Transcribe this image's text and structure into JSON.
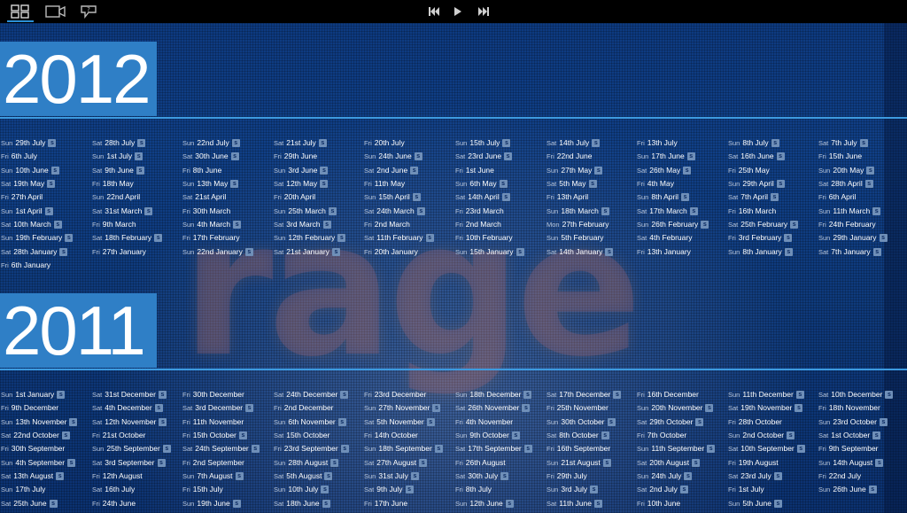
{
  "toolbar": {
    "icons": [
      "grid-view-icon",
      "video-camera-icon",
      "help-icon",
      "skip-back-icon",
      "play-icon",
      "skip-forward-icon"
    ]
  },
  "s_label": "s",
  "sections": [
    {
      "year": "2012",
      "entries": [
        {
          "day": "Sun",
          "date": "29th July",
          "s": true
        },
        {
          "day": "Sat",
          "date": "28th July",
          "s": true
        },
        {
          "day": "Sun",
          "date": "22nd July",
          "s": true
        },
        {
          "day": "Sat",
          "date": "21st July",
          "s": true
        },
        {
          "day": "Fri",
          "date": "20th July",
          "s": false
        },
        {
          "day": "Sun",
          "date": "15th July",
          "s": true
        },
        {
          "day": "Sat",
          "date": "14th July",
          "s": true
        },
        {
          "day": "Fri",
          "date": "13th July",
          "s": false
        },
        {
          "day": "Sun",
          "date": "8th July",
          "s": true
        },
        {
          "day": "Sat",
          "date": "7th July",
          "s": true
        },
        {
          "day": "Fri",
          "date": "6th July",
          "s": false
        },
        {
          "day": "Sun",
          "date": "1st July",
          "s": true
        },
        {
          "day": "Sat",
          "date": "30th June",
          "s": true
        },
        {
          "day": "Fri",
          "date": "29th June",
          "s": false
        },
        {
          "day": "Sun",
          "date": "24th June",
          "s": true
        },
        {
          "day": "Sat",
          "date": "23rd June",
          "s": true
        },
        {
          "day": "Fri",
          "date": "22nd June",
          "s": false
        },
        {
          "day": "Sun",
          "date": "17th June",
          "s": true
        },
        {
          "day": "Sat",
          "date": "16th June",
          "s": true
        },
        {
          "day": "Fri",
          "date": "15th June",
          "s": false
        },
        {
          "day": "Sun",
          "date": "10th June",
          "s": true
        },
        {
          "day": "Sat",
          "date": "9th June",
          "s": true
        },
        {
          "day": "Fri",
          "date": "8th June",
          "s": false
        },
        {
          "day": "Sun",
          "date": "3rd June",
          "s": true
        },
        {
          "day": "Sat",
          "date": "2nd June",
          "s": true
        },
        {
          "day": "Fri",
          "date": "1st June",
          "s": false
        },
        {
          "day": "Sun",
          "date": "27th May",
          "s": true
        },
        {
          "day": "Sat",
          "date": "26th May",
          "s": true
        },
        {
          "day": "Fri",
          "date": "25th May",
          "s": false
        },
        {
          "day": "Sun",
          "date": "20th May",
          "s": true
        },
        {
          "day": "Sat",
          "date": "19th May",
          "s": true
        },
        {
          "day": "Fri",
          "date": "18th May",
          "s": false
        },
        {
          "day": "Sun",
          "date": "13th May",
          "s": true
        },
        {
          "day": "Sat",
          "date": "12th May",
          "s": true
        },
        {
          "day": "Fri",
          "date": "11th May",
          "s": false
        },
        {
          "day": "Sun",
          "date": "6th May",
          "s": true
        },
        {
          "day": "Sat",
          "date": "5th May",
          "s": true
        },
        {
          "day": "Fri",
          "date": "4th May",
          "s": false
        },
        {
          "day": "Sun",
          "date": "29th April",
          "s": true
        },
        {
          "day": "Sat",
          "date": "28th April",
          "s": true
        },
        {
          "day": "Fri",
          "date": "27th April",
          "s": false
        },
        {
          "day": "Sun",
          "date": "22nd April",
          "s": false
        },
        {
          "day": "Sat",
          "date": "21st April",
          "s": false
        },
        {
          "day": "Fri",
          "date": "20th April",
          "s": false
        },
        {
          "day": "Sun",
          "date": "15th April",
          "s": true
        },
        {
          "day": "Sat",
          "date": "14th April",
          "s": true
        },
        {
          "day": "Fri",
          "date": "13th April",
          "s": false
        },
        {
          "day": "Sun",
          "date": "8th April",
          "s": true
        },
        {
          "day": "Sat",
          "date": "7th April",
          "s": true
        },
        {
          "day": "Fri",
          "date": "6th April",
          "s": false
        },
        {
          "day": "Sun",
          "date": "1st April",
          "s": true
        },
        {
          "day": "Sat",
          "date": "31st March",
          "s": true
        },
        {
          "day": "Fri",
          "date": "30th March",
          "s": false
        },
        {
          "day": "Sun",
          "date": "25th March",
          "s": true
        },
        {
          "day": "Sat",
          "date": "24th March",
          "s": true
        },
        {
          "day": "Fri",
          "date": "23rd March",
          "s": false
        },
        {
          "day": "Sun",
          "date": "18th March",
          "s": true
        },
        {
          "day": "Sat",
          "date": "17th March",
          "s": true
        },
        {
          "day": "Fri",
          "date": "16th March",
          "s": false
        },
        {
          "day": "Sun",
          "date": "11th March",
          "s": true
        },
        {
          "day": "Sat",
          "date": "10th March",
          "s": true
        },
        {
          "day": "Fri",
          "date": "9th March",
          "s": false
        },
        {
          "day": "Sun",
          "date": "4th March",
          "s": true
        },
        {
          "day": "Sat",
          "date": "3rd March",
          "s": true
        },
        {
          "day": "Fri",
          "date": "2nd March",
          "s": false
        },
        {
          "day": "Fri",
          "date": "2nd March",
          "s": false
        },
        {
          "day": "Mon",
          "date": "27th February",
          "s": false
        },
        {
          "day": "Sun",
          "date": "26th February",
          "s": true
        },
        {
          "day": "Sat",
          "date": "25th February",
          "s": true
        },
        {
          "day": "Fri",
          "date": "24th February",
          "s": false
        },
        {
          "day": "Sun",
          "date": "19th February",
          "s": true
        },
        {
          "day": "Sat",
          "date": "18th February",
          "s": true
        },
        {
          "day": "Fri",
          "date": "17th February",
          "s": false
        },
        {
          "day": "Sun",
          "date": "12th February",
          "s": true
        },
        {
          "day": "Sat",
          "date": "11th February",
          "s": true
        },
        {
          "day": "Fri",
          "date": "10th February",
          "s": false
        },
        {
          "day": "Sun",
          "date": "5th February",
          "s": false
        },
        {
          "day": "Sat",
          "date": "4th February",
          "s": false
        },
        {
          "day": "Fri",
          "date": "3rd February",
          "s": true
        },
        {
          "day": "Sun",
          "date": "29th January",
          "s": true
        },
        {
          "day": "Sat",
          "date": "28th January",
          "s": true
        },
        {
          "day": "Fri",
          "date": "27th January",
          "s": false
        },
        {
          "day": "Sun",
          "date": "22nd January",
          "s": true
        },
        {
          "day": "Sat",
          "date": "21st January",
          "s": true
        },
        {
          "day": "Fri",
          "date": "20th January",
          "s": false
        },
        {
          "day": "Sun",
          "date": "15th January",
          "s": true
        },
        {
          "day": "Sat",
          "date": "14th January",
          "s": true
        },
        {
          "day": "Fri",
          "date": "13th January",
          "s": false
        },
        {
          "day": "Sun",
          "date": "8th January",
          "s": true
        },
        {
          "day": "Sat",
          "date": "7th January",
          "s": true
        },
        {
          "day": "Fri",
          "date": "6th January",
          "s": false
        }
      ]
    },
    {
      "year": "2011",
      "entries": [
        {
          "day": "Sun",
          "date": "1st January",
          "s": true
        },
        {
          "day": "Sat",
          "date": "31st December",
          "s": true
        },
        {
          "day": "Fri",
          "date": "30th December",
          "s": false
        },
        {
          "day": "Sat",
          "date": "24th December",
          "s": true
        },
        {
          "day": "Fri",
          "date": "23rd December",
          "s": false
        },
        {
          "day": "Sun",
          "date": "18th December",
          "s": true
        },
        {
          "day": "Sat",
          "date": "17th December",
          "s": true
        },
        {
          "day": "Fri",
          "date": "16th December",
          "s": false
        },
        {
          "day": "Sun",
          "date": "11th December",
          "s": true
        },
        {
          "day": "Sat",
          "date": "10th December",
          "s": true
        },
        {
          "day": "Fri",
          "date": "9th December",
          "s": false
        },
        {
          "day": "Sat",
          "date": "4th December",
          "s": true
        },
        {
          "day": "Sat",
          "date": "3rd December",
          "s": true
        },
        {
          "day": "Fri",
          "date": "2nd December",
          "s": false
        },
        {
          "day": "Sun",
          "date": "27th November",
          "s": true
        },
        {
          "day": "Sat",
          "date": "26th November",
          "s": true
        },
        {
          "day": "Fri",
          "date": "25th November",
          "s": false
        },
        {
          "day": "Sun",
          "date": "20th November",
          "s": true
        },
        {
          "day": "Sat",
          "date": "19th November",
          "s": true
        },
        {
          "day": "Fri",
          "date": "18th November",
          "s": false
        },
        {
          "day": "Sun",
          "date": "13th November",
          "s": true
        },
        {
          "day": "Sat",
          "date": "12th November",
          "s": true
        },
        {
          "day": "Fri",
          "date": "11th November",
          "s": false
        },
        {
          "day": "Sun",
          "date": "6th November",
          "s": true
        },
        {
          "day": "Sat",
          "date": "5th November",
          "s": true
        },
        {
          "day": "Fri",
          "date": "4th November",
          "s": false
        },
        {
          "day": "Sun",
          "date": "30th October",
          "s": true
        },
        {
          "day": "Sat",
          "date": "29th October",
          "s": true
        },
        {
          "day": "Fri",
          "date": "28th October",
          "s": false
        },
        {
          "day": "Sun",
          "date": "23rd October",
          "s": true
        },
        {
          "day": "Sat",
          "date": "22nd October",
          "s": true
        },
        {
          "day": "Fri",
          "date": "21st October",
          "s": false
        },
        {
          "day": "Fri",
          "date": "15th October",
          "s": true
        },
        {
          "day": "Sat",
          "date": "15th October",
          "s": false
        },
        {
          "day": "Fri",
          "date": "14th October",
          "s": false
        },
        {
          "day": "Sun",
          "date": "9th October",
          "s": true
        },
        {
          "day": "Sat",
          "date": "8th October",
          "s": true
        },
        {
          "day": "Fri",
          "date": "7th October",
          "s": false
        },
        {
          "day": "Sun",
          "date": "2nd October",
          "s": true
        },
        {
          "day": "Sat",
          "date": "1st October",
          "s": true
        },
        {
          "day": "Fri",
          "date": "30th September",
          "s": false
        },
        {
          "day": "Sun",
          "date": "25th September",
          "s": true
        },
        {
          "day": "Sat",
          "date": "24th September",
          "s": true
        },
        {
          "day": "Fri",
          "date": "23rd September",
          "s": true
        },
        {
          "day": "Sun",
          "date": "18th September",
          "s": true
        },
        {
          "day": "Sat",
          "date": "17th September",
          "s": true
        },
        {
          "day": "Fri",
          "date": "16th September",
          "s": false
        },
        {
          "day": "Sun",
          "date": "11th September",
          "s": true
        },
        {
          "day": "Sat",
          "date": "10th September",
          "s": true
        },
        {
          "day": "Fri",
          "date": "9th September",
          "s": false
        },
        {
          "day": "Sun",
          "date": "4th September",
          "s": true
        },
        {
          "day": "Sat",
          "date": "3rd September",
          "s": true
        },
        {
          "day": "Fri",
          "date": "2nd September",
          "s": false
        },
        {
          "day": "Sun",
          "date": "28th August",
          "s": true
        },
        {
          "day": "Sat",
          "date": "27th August",
          "s": true
        },
        {
          "day": "Fri",
          "date": "26th August",
          "s": false
        },
        {
          "day": "Sun",
          "date": "21st August",
          "s": true
        },
        {
          "day": "Sat",
          "date": "20th August",
          "s": true
        },
        {
          "day": "Fri",
          "date": "19th August",
          "s": false
        },
        {
          "day": "Sun",
          "date": "14th August",
          "s": true
        },
        {
          "day": "Sat",
          "date": "13th August",
          "s": true
        },
        {
          "day": "Fri",
          "date": "12th August",
          "s": false
        },
        {
          "day": "Sun",
          "date": "7th August",
          "s": true
        },
        {
          "day": "Sat",
          "date": "5th August",
          "s": true
        },
        {
          "day": "Sun",
          "date": "31st July",
          "s": true
        },
        {
          "day": "Sat",
          "date": "30th July",
          "s": true
        },
        {
          "day": "Fri",
          "date": "29th July",
          "s": false
        },
        {
          "day": "Sun",
          "date": "24th July",
          "s": true
        },
        {
          "day": "Sat",
          "date": "23rd July",
          "s": true
        },
        {
          "day": "Fri",
          "date": "22nd July",
          "s": false
        },
        {
          "day": "Sun",
          "date": "17th July",
          "s": false
        },
        {
          "day": "Sat",
          "date": "16th July",
          "s": false
        },
        {
          "day": "Fri",
          "date": "15th July",
          "s": false
        },
        {
          "day": "Sun",
          "date": "10th July",
          "s": true
        },
        {
          "day": "Sat",
          "date": "9th July",
          "s": true
        },
        {
          "day": "Fri",
          "date": "8th July",
          "s": false
        },
        {
          "day": "Sun",
          "date": "3rd July",
          "s": true
        },
        {
          "day": "Sat",
          "date": "2nd July",
          "s": true
        },
        {
          "day": "Fri",
          "date": "1st July",
          "s": false
        },
        {
          "day": "Sun",
          "date": "26th June",
          "s": true
        },
        {
          "day": "Sat",
          "date": "25th June",
          "s": true
        },
        {
          "day": "Fri",
          "date": "24th June",
          "s": false
        },
        {
          "day": "Sun",
          "date": "19th June",
          "s": true
        },
        {
          "day": "Sat",
          "date": "18th June",
          "s": true
        },
        {
          "day": "Fri",
          "date": "17th June",
          "s": false
        },
        {
          "day": "Sun",
          "date": "12th June",
          "s": true
        },
        {
          "day": "Sat",
          "date": "11th June",
          "s": true
        },
        {
          "day": "Fri",
          "date": "10th June",
          "s": false
        },
        {
          "day": "Sun",
          "date": "5th June",
          "s": true
        }
      ]
    }
  ]
}
